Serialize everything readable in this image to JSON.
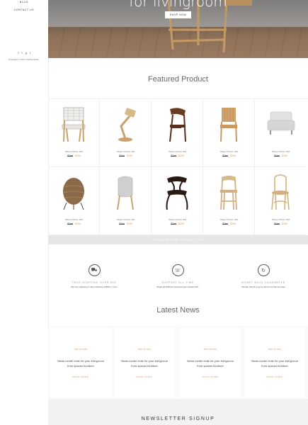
{
  "sidebar": {
    "nav": [
      "BLOG",
      "CONTACT US"
    ],
    "socials": [
      "f",
      "t",
      "g",
      "i"
    ],
    "copyright": "Copyright © 2016. OwlTemplate"
  },
  "hero": {
    "title": "for livingroom",
    "button": "SHOP NOW"
  },
  "featured": {
    "title": "Featured Product",
    "products": [
      {
        "name": "Weary Partum ddd",
        "old_price": "$2ee",
        "new_price": "$199",
        "icon": "woven-chair-icon"
      },
      {
        "name": "Weary Partum ddd",
        "old_price": "$2ee",
        "new_price": "$199",
        "icon": "desk-lamp-icon"
      },
      {
        "name": "Weary Partum ddd",
        "old_price": "$2ee",
        "new_price": "$199",
        "icon": "wood-chair-icon"
      },
      {
        "name": "Weary Partum ddd",
        "old_price": "$2ee",
        "new_price": "$199",
        "icon": "slat-chair-icon"
      },
      {
        "name": "Weary Partum ddd",
        "old_price": "$2ee",
        "new_price": "$199",
        "icon": "armchair-icon"
      },
      {
        "name": "Weary Partum ddd",
        "old_price": "$2ee",
        "new_price": "$199",
        "icon": "pendant-lamp-icon"
      },
      {
        "name": "Weary Partum ddd",
        "old_price": "$2ee",
        "new_price": "$199",
        "icon": "shell-chair-icon"
      },
      {
        "name": "Weary Partum ddd",
        "old_price": "$2ee",
        "new_price": "$199",
        "icon": "dark-chair-icon"
      },
      {
        "name": "Weary Partum ddd",
        "old_price": "$2ee",
        "new_price": "$199",
        "icon": "bar-stool-icon"
      },
      {
        "name": "Weary Partum ddd",
        "old_price": "$2ee",
        "new_price": "$199",
        "icon": "bentwood-chair-icon"
      }
    ],
    "load_more": "LOAD MORE PRODUCTS"
  },
  "features": [
    {
      "icon": "truck-icon",
      "title": "FREE SHIPPING OVER $99",
      "text": "We free shipping on all purchases of $99 or more"
    },
    {
      "icon": "support-icon",
      "title": "SUPPORT ALL TIME",
      "text": "Begin all fulfilment that has been ahead 24/7"
    },
    {
      "icon": "refresh-icon",
      "title": "MONEY BACK GUARANTEE",
      "text": "We like clients to get a refund of what we have"
    }
  ],
  "news": {
    "title": "Latest News",
    "posts": [
      {
        "date": "MAY 04 2016",
        "text": "News model chair for your livingroom from spaces furniture",
        "more": "READ MORE"
      },
      {
        "date": "MAY 04 2016",
        "text": "News model chair for your livingroom from spaces furniture",
        "more": "READ MORE"
      },
      {
        "date": "MAY 04 2016",
        "text": "News model chair for your livingroom from spaces furniture",
        "more": "READ MORE"
      },
      {
        "date": "MAY 04 2016",
        "text": "News model chair for your livingroom from spaces furniture",
        "more": "READ MORE"
      }
    ]
  },
  "newsletter": {
    "title": "NEWSLETTER SIGNUP"
  },
  "colors": {
    "accent": "#c79a6a",
    "muted": "#999999"
  }
}
